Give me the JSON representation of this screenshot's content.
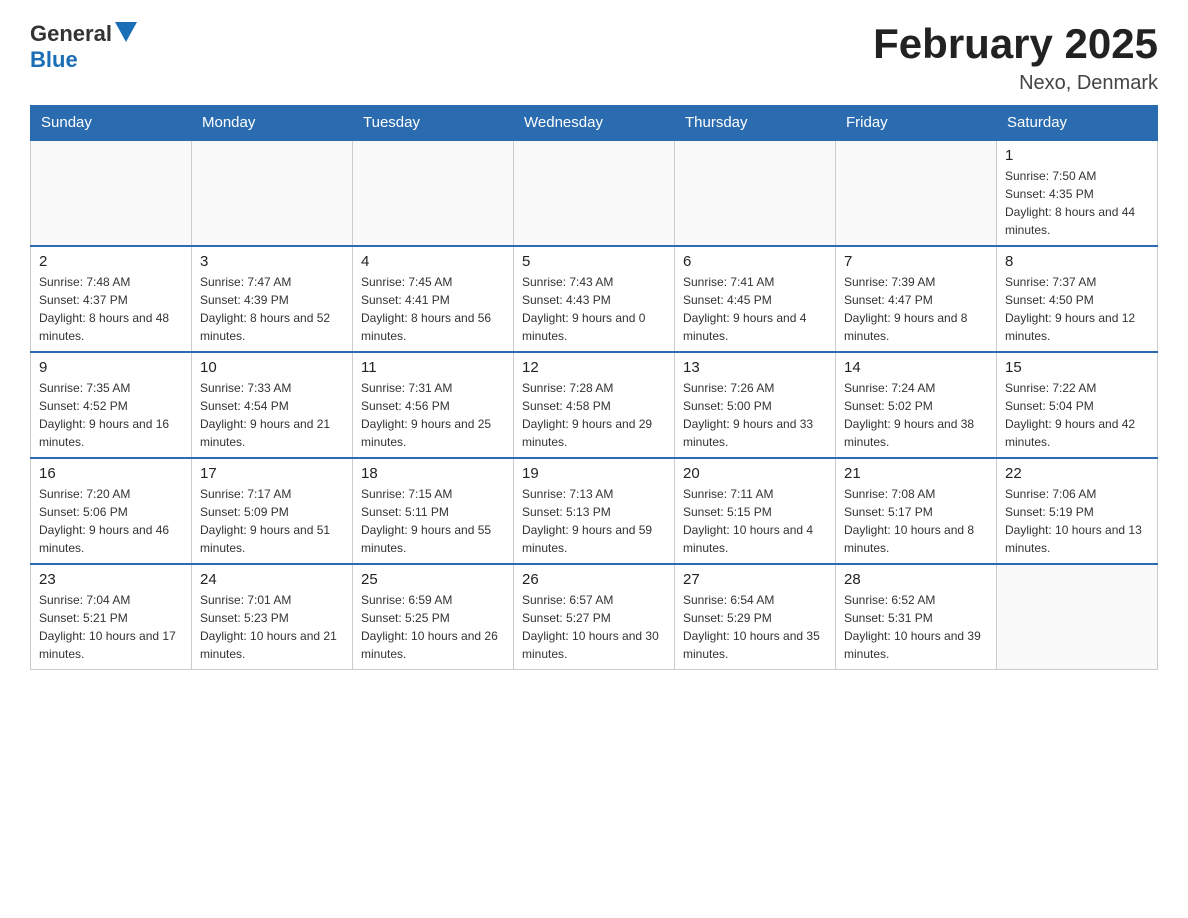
{
  "logo": {
    "text_general": "General",
    "text_blue": "Blue"
  },
  "title": "February 2025",
  "subtitle": "Nexo, Denmark",
  "weekdays": [
    "Sunday",
    "Monday",
    "Tuesday",
    "Wednesday",
    "Thursday",
    "Friday",
    "Saturday"
  ],
  "weeks": [
    {
      "days": [
        {
          "number": "",
          "empty": true
        },
        {
          "number": "",
          "empty": true
        },
        {
          "number": "",
          "empty": true
        },
        {
          "number": "",
          "empty": true
        },
        {
          "number": "",
          "empty": true
        },
        {
          "number": "",
          "empty": true
        },
        {
          "number": "1",
          "sunrise": "Sunrise: 7:50 AM",
          "sunset": "Sunset: 4:35 PM",
          "daylight": "Daylight: 8 hours and 44 minutes."
        }
      ]
    },
    {
      "days": [
        {
          "number": "2",
          "sunrise": "Sunrise: 7:48 AM",
          "sunset": "Sunset: 4:37 PM",
          "daylight": "Daylight: 8 hours and 48 minutes."
        },
        {
          "number": "3",
          "sunrise": "Sunrise: 7:47 AM",
          "sunset": "Sunset: 4:39 PM",
          "daylight": "Daylight: 8 hours and 52 minutes."
        },
        {
          "number": "4",
          "sunrise": "Sunrise: 7:45 AM",
          "sunset": "Sunset: 4:41 PM",
          "daylight": "Daylight: 8 hours and 56 minutes."
        },
        {
          "number": "5",
          "sunrise": "Sunrise: 7:43 AM",
          "sunset": "Sunset: 4:43 PM",
          "daylight": "Daylight: 9 hours and 0 minutes."
        },
        {
          "number": "6",
          "sunrise": "Sunrise: 7:41 AM",
          "sunset": "Sunset: 4:45 PM",
          "daylight": "Daylight: 9 hours and 4 minutes."
        },
        {
          "number": "7",
          "sunrise": "Sunrise: 7:39 AM",
          "sunset": "Sunset: 4:47 PM",
          "daylight": "Daylight: 9 hours and 8 minutes."
        },
        {
          "number": "8",
          "sunrise": "Sunrise: 7:37 AM",
          "sunset": "Sunset: 4:50 PM",
          "daylight": "Daylight: 9 hours and 12 minutes."
        }
      ]
    },
    {
      "days": [
        {
          "number": "9",
          "sunrise": "Sunrise: 7:35 AM",
          "sunset": "Sunset: 4:52 PM",
          "daylight": "Daylight: 9 hours and 16 minutes."
        },
        {
          "number": "10",
          "sunrise": "Sunrise: 7:33 AM",
          "sunset": "Sunset: 4:54 PM",
          "daylight": "Daylight: 9 hours and 21 minutes."
        },
        {
          "number": "11",
          "sunrise": "Sunrise: 7:31 AM",
          "sunset": "Sunset: 4:56 PM",
          "daylight": "Daylight: 9 hours and 25 minutes."
        },
        {
          "number": "12",
          "sunrise": "Sunrise: 7:28 AM",
          "sunset": "Sunset: 4:58 PM",
          "daylight": "Daylight: 9 hours and 29 minutes."
        },
        {
          "number": "13",
          "sunrise": "Sunrise: 7:26 AM",
          "sunset": "Sunset: 5:00 PM",
          "daylight": "Daylight: 9 hours and 33 minutes."
        },
        {
          "number": "14",
          "sunrise": "Sunrise: 7:24 AM",
          "sunset": "Sunset: 5:02 PM",
          "daylight": "Daylight: 9 hours and 38 minutes."
        },
        {
          "number": "15",
          "sunrise": "Sunrise: 7:22 AM",
          "sunset": "Sunset: 5:04 PM",
          "daylight": "Daylight: 9 hours and 42 minutes."
        }
      ]
    },
    {
      "days": [
        {
          "number": "16",
          "sunrise": "Sunrise: 7:20 AM",
          "sunset": "Sunset: 5:06 PM",
          "daylight": "Daylight: 9 hours and 46 minutes."
        },
        {
          "number": "17",
          "sunrise": "Sunrise: 7:17 AM",
          "sunset": "Sunset: 5:09 PM",
          "daylight": "Daylight: 9 hours and 51 minutes."
        },
        {
          "number": "18",
          "sunrise": "Sunrise: 7:15 AM",
          "sunset": "Sunset: 5:11 PM",
          "daylight": "Daylight: 9 hours and 55 minutes."
        },
        {
          "number": "19",
          "sunrise": "Sunrise: 7:13 AM",
          "sunset": "Sunset: 5:13 PM",
          "daylight": "Daylight: 9 hours and 59 minutes."
        },
        {
          "number": "20",
          "sunrise": "Sunrise: 7:11 AM",
          "sunset": "Sunset: 5:15 PM",
          "daylight": "Daylight: 10 hours and 4 minutes."
        },
        {
          "number": "21",
          "sunrise": "Sunrise: 7:08 AM",
          "sunset": "Sunset: 5:17 PM",
          "daylight": "Daylight: 10 hours and 8 minutes."
        },
        {
          "number": "22",
          "sunrise": "Sunrise: 7:06 AM",
          "sunset": "Sunset: 5:19 PM",
          "daylight": "Daylight: 10 hours and 13 minutes."
        }
      ]
    },
    {
      "days": [
        {
          "number": "23",
          "sunrise": "Sunrise: 7:04 AM",
          "sunset": "Sunset: 5:21 PM",
          "daylight": "Daylight: 10 hours and 17 minutes."
        },
        {
          "number": "24",
          "sunrise": "Sunrise: 7:01 AM",
          "sunset": "Sunset: 5:23 PM",
          "daylight": "Daylight: 10 hours and 21 minutes."
        },
        {
          "number": "25",
          "sunrise": "Sunrise: 6:59 AM",
          "sunset": "Sunset: 5:25 PM",
          "daylight": "Daylight: 10 hours and 26 minutes."
        },
        {
          "number": "26",
          "sunrise": "Sunrise: 6:57 AM",
          "sunset": "Sunset: 5:27 PM",
          "daylight": "Daylight: 10 hours and 30 minutes."
        },
        {
          "number": "27",
          "sunrise": "Sunrise: 6:54 AM",
          "sunset": "Sunset: 5:29 PM",
          "daylight": "Daylight: 10 hours and 35 minutes."
        },
        {
          "number": "28",
          "sunrise": "Sunrise: 6:52 AM",
          "sunset": "Sunset: 5:31 PM",
          "daylight": "Daylight: 10 hours and 39 minutes."
        },
        {
          "number": "",
          "empty": true
        }
      ]
    }
  ]
}
